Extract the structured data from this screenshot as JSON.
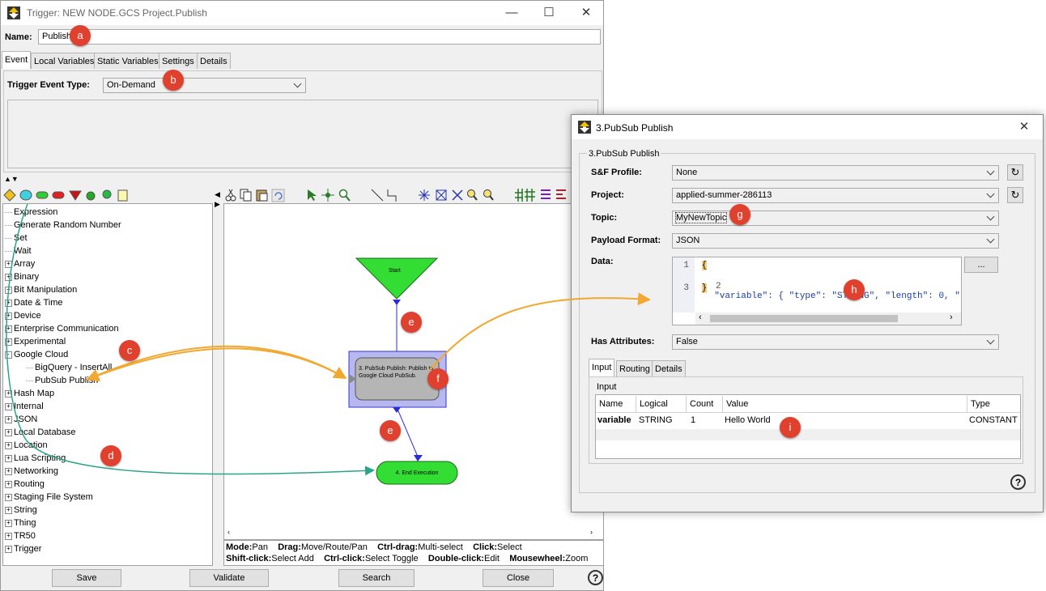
{
  "main_window": {
    "title": "Trigger:  NEW NODE.GCS Project.Publish",
    "name_label": "Name:",
    "name_value": "Publish",
    "tabs": [
      "Event",
      "Local Variables",
      "Static Variables",
      "Settings",
      "Details"
    ],
    "trigger_event_label": "Trigger Event Type:",
    "trigger_event_value": "On-Demand"
  },
  "tree": {
    "items": [
      {
        "label": "Expression",
        "expandable": false,
        "indent": 0
      },
      {
        "label": "Generate Random Number",
        "expandable": false,
        "indent": 0
      },
      {
        "label": "Set",
        "expandable": false,
        "indent": 0
      },
      {
        "label": "Wait",
        "expandable": false,
        "indent": 0
      },
      {
        "label": "Array",
        "expandable": true,
        "indent": 0
      },
      {
        "label": "Binary",
        "expandable": true,
        "indent": 0
      },
      {
        "label": "Bit Manipulation",
        "expandable": true,
        "indent": 0
      },
      {
        "label": "Date & Time",
        "expandable": true,
        "indent": 0
      },
      {
        "label": "Device",
        "expandable": true,
        "indent": 0
      },
      {
        "label": "Enterprise Communication",
        "expandable": true,
        "indent": 0
      },
      {
        "label": "Experimental",
        "expandable": true,
        "indent": 0
      },
      {
        "label": "Google Cloud",
        "expandable": true,
        "expanded": true,
        "indent": 0
      },
      {
        "label": "BigQuery - InsertAll",
        "expandable": false,
        "indent": 1
      },
      {
        "label": "PubSub Publish",
        "expandable": false,
        "indent": 1
      },
      {
        "label": "Hash Map",
        "expandable": true,
        "indent": 0
      },
      {
        "label": "Internal",
        "expandable": true,
        "indent": 0
      },
      {
        "label": "JSON",
        "expandable": true,
        "indent": 0
      },
      {
        "label": "Local Database",
        "expandable": true,
        "indent": 0
      },
      {
        "label": "Location",
        "expandable": true,
        "indent": 0
      },
      {
        "label": "Lua Scripting",
        "expandable": true,
        "indent": 0
      },
      {
        "label": "Networking",
        "expandable": true,
        "indent": 0
      },
      {
        "label": "Routing",
        "expandable": true,
        "indent": 0
      },
      {
        "label": "Staging File System",
        "expandable": true,
        "indent": 0
      },
      {
        "label": "String",
        "expandable": true,
        "indent": 0
      },
      {
        "label": "Thing",
        "expandable": true,
        "indent": 0
      },
      {
        "label": "TR50",
        "expandable": true,
        "indent": 0
      },
      {
        "label": "Trigger",
        "expandable": true,
        "indent": 0
      }
    ]
  },
  "canvas": {
    "start_label": "Start",
    "publish_node_label": "3. PubSub Publish: Publish to Google Cloud PubSub.",
    "end_label": "4. End Execution"
  },
  "statusbar": {
    "line1": [
      {
        "key": "Mode:",
        "val": "Pan"
      },
      {
        "key": "Drag:",
        "val": "Move/Route/Pan"
      },
      {
        "key": "Ctrl-drag:",
        "val": "Multi-select"
      },
      {
        "key": "Click:",
        "val": "Select"
      }
    ],
    "line2": [
      {
        "key": "Shift-click:",
        "val": "Select Add"
      },
      {
        "key": "Ctrl-click:",
        "val": "Select Toggle"
      },
      {
        "key": "Double-click:",
        "val": "Edit"
      },
      {
        "key": "Mousewheel:",
        "val": "Zoom"
      }
    ]
  },
  "buttons": {
    "save": "Save",
    "validate": "Validate",
    "search": "Search",
    "close": "Close"
  },
  "dialog": {
    "title": "3.PubSub Publish",
    "group_title": "3.PubSub Publish",
    "sf_profile_label": "S&F Profile:",
    "sf_profile_value": "None",
    "project_label": "Project:",
    "project_value": "applied-summer-286113",
    "topic_label": "Topic:",
    "topic_value": "MyNewTopic",
    "payload_label": "Payload Format:",
    "payload_value": "JSON",
    "data_label": "Data:",
    "data_lines": [
      {
        "num": "1",
        "text": "{"
      },
      {
        "num": "2",
        "text": " \"variable\": { \"type\": \"STRING\", \"length\": 0, \""
      },
      {
        "num": "3",
        "text": "}"
      }
    ],
    "ellipsis_button": "...",
    "has_attributes_label": "Has Attributes:",
    "has_attributes_value": "False",
    "tabs": [
      "Input",
      "Routing",
      "Details"
    ],
    "input_group_title": "Input",
    "table_headers": [
      "Name",
      "Logical",
      "Count",
      "Value",
      "Type"
    ],
    "table_rows": [
      {
        "name": "variable",
        "logical": "STRING",
        "count": "1",
        "value": "Hello World",
        "type": "CONSTANT"
      }
    ]
  },
  "markers": [
    "a",
    "b",
    "c",
    "d",
    "e",
    "e",
    "f",
    "g",
    "h",
    "i"
  ],
  "colors": {
    "marker": "#e0412f",
    "orange_arrow": "#f0a830",
    "teal_arrow": "#2aa58a",
    "start_green": "#33dd33",
    "node_selected": "#b8b8f0",
    "connector": "#2b2bd9"
  }
}
